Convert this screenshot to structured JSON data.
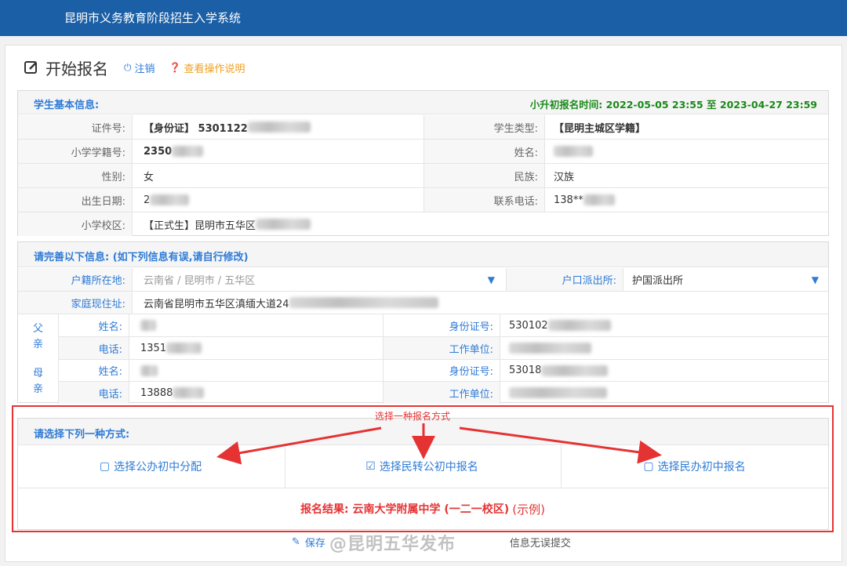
{
  "app": {
    "title": "昆明市义务教育阶段招生入学系统"
  },
  "header": {
    "page_title": "开始报名",
    "logout_label": "注销",
    "help_label": "查看操作说明"
  },
  "basic": {
    "section_label": "学生基本信息:",
    "time_label": "小升初报名时间: 2022-05-05 23:55 至 2023-04-27 23:59",
    "id_label": "证件号:",
    "id_value": "【身份证】 5301122",
    "type_label": "学生类型:",
    "type_value": "【昆明主城区学籍】",
    "student_no_label": "小学学籍号:",
    "student_no_value": "2350",
    "name_label": "姓名:",
    "gender_label": "性别:",
    "gender_value": "女",
    "ethnicity_label": "民族:",
    "ethnicity_value": "汉族",
    "birth_label": "出生日期:",
    "birth_value": "2",
    "phone_label": "联系电话:",
    "phone_value": "138**",
    "school_label": "小学校区:",
    "school_value": "【正式生】昆明市五华区"
  },
  "complete": {
    "section_label": "请完善以下信息:  (如下列信息有误,请自行修改)",
    "hukou_label": "户籍所在地:",
    "hukou_value": "云南省 / 昆明市 / 五华区",
    "police_label": "户口派出所:",
    "police_value": "护国派出所",
    "address_label": "家庭现住址:",
    "address_value": "云南省昆明市五华区滇缅大道24",
    "father_label": "父亲",
    "mother_label": "母亲",
    "name_label": "姓名:",
    "phone_label": "电话:",
    "idcard_label": "身份证号:",
    "work_label": "工作单位:",
    "father_phone": "1351",
    "father_id": "530102",
    "mother_phone": "13888",
    "mother_id": "53018"
  },
  "choose": {
    "section_label": "请选择下列一种方式:",
    "annotation": "选择一种报名方式",
    "option_public": "选择公办初中分配",
    "option_transfer": "选择民转公初中报名",
    "option_private": "选择民办初中报名",
    "result_label": "报名结果: 云南大学附属中学 (一二一校区)",
    "result_note": "(示例)"
  },
  "footer": {
    "save_label": "保存",
    "submit_label": "信息无误提交",
    "watermark": "@昆明五华发布"
  },
  "colors": {
    "brand": "#1b5fa6",
    "accent": "#2f7bd6",
    "alert": "#e53333",
    "time": "#1a8a1a"
  }
}
